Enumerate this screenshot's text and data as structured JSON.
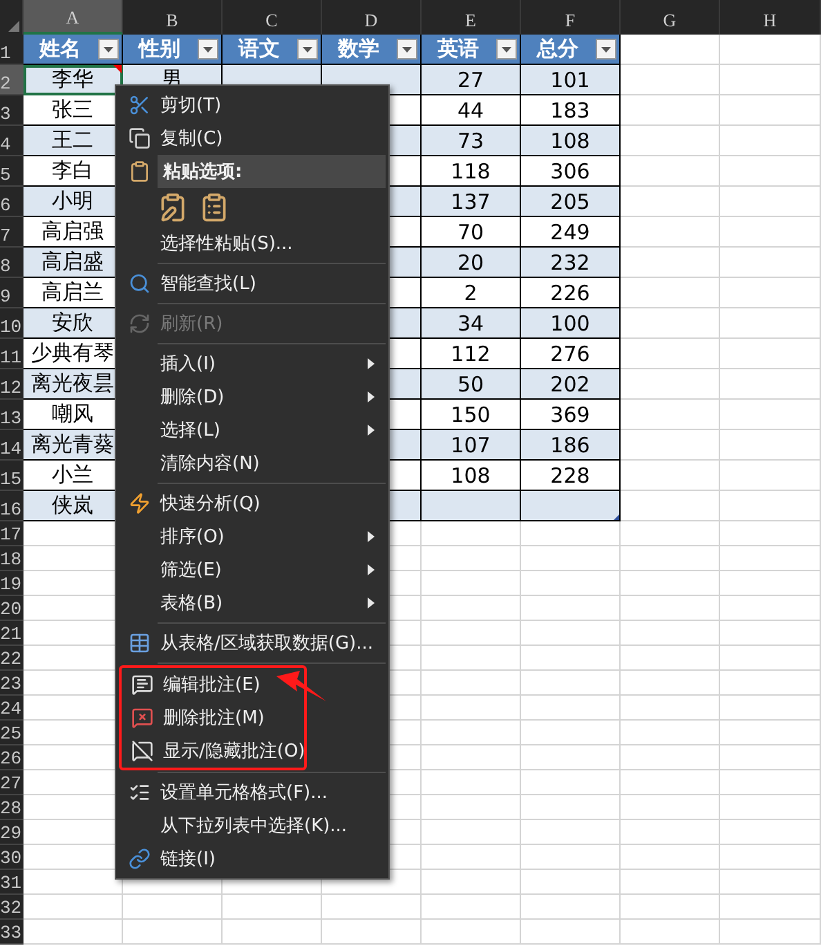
{
  "column_headers": [
    {
      "label": "A",
      "selected": true
    },
    {
      "label": "B",
      "selected": false
    },
    {
      "label": "C",
      "selected": false
    },
    {
      "label": "D",
      "selected": false
    },
    {
      "label": "E",
      "selected": false
    },
    {
      "label": "F",
      "selected": false
    },
    {
      "label": "G",
      "selected": false
    },
    {
      "label": "H",
      "selected": false
    }
  ],
  "row_numbers": [
    "1",
    "2",
    "3",
    "4",
    "5",
    "6",
    "7",
    "8",
    "9",
    "10",
    "11",
    "12",
    "13",
    "14",
    "15",
    "16",
    "17",
    "18",
    "19",
    "20",
    "21",
    "22",
    "23",
    "24",
    "25",
    "26",
    "27",
    "28",
    "29",
    "30",
    "31",
    "32",
    "33"
  ],
  "table": {
    "columns": [
      "姓名",
      "性别",
      "语文",
      "数学",
      "英语",
      "总分"
    ],
    "rows": [
      {
        "name": "李华",
        "gender": "男",
        "english": "27",
        "total": "101",
        "selected": true,
        "has_comment": true
      },
      {
        "name": "张三",
        "english": "44",
        "total": "183",
        "selected": false,
        "has_comment": false
      },
      {
        "name": "王二",
        "english": "73",
        "total": "108",
        "selected": false,
        "has_comment": false
      },
      {
        "name": "李白",
        "english": "118",
        "total": "306",
        "selected": false,
        "has_comment": false
      },
      {
        "name": "小明",
        "english": "137",
        "total": "205",
        "selected": false,
        "has_comment": false
      },
      {
        "name": "高启强",
        "english": "70",
        "total": "249",
        "selected": false,
        "has_comment": false
      },
      {
        "name": "高启盛",
        "english": "20",
        "total": "232",
        "selected": false,
        "has_comment": false
      },
      {
        "name": "高启兰",
        "english": "2",
        "total": "226",
        "selected": false,
        "has_comment": false
      },
      {
        "name": "安欣",
        "english": "34",
        "total": "100",
        "selected": false,
        "has_comment": false
      },
      {
        "name": "少典有琴",
        "english": "112",
        "total": "276",
        "selected": false,
        "has_comment": false
      },
      {
        "name": "离光夜昙",
        "english": "50",
        "total": "202",
        "selected": false,
        "has_comment": false
      },
      {
        "name": "嘲风",
        "english": "150",
        "total": "369",
        "selected": false,
        "has_comment": false
      },
      {
        "name": "离光青葵",
        "english": "107",
        "total": "186",
        "selected": false,
        "has_comment": false
      },
      {
        "name": "小兰",
        "english": "108",
        "total": "228",
        "selected": false,
        "has_comment": false
      },
      {
        "name": "侠岚",
        "selected": false,
        "has_comment": false
      }
    ]
  },
  "context_menu": {
    "items": [
      {
        "kind": "command",
        "label": "剪切(T)",
        "disabled": false,
        "highlighted": false,
        "annotated": false
      },
      {
        "kind": "command",
        "label": "复制(C)",
        "disabled": false,
        "highlighted": false,
        "annotated": false
      },
      {
        "kind": "header",
        "label": "粘贴选项:",
        "disabled": false,
        "highlighted": true,
        "annotated": false
      },
      {
        "kind": "paste_icons"
      },
      {
        "kind": "command",
        "label": "选择性粘贴(S)...",
        "disabled": false,
        "highlighted": false,
        "annotated": false
      },
      {
        "kind": "separator"
      },
      {
        "kind": "command",
        "label": "智能查找(L)",
        "disabled": false,
        "highlighted": false,
        "annotated": false
      },
      {
        "kind": "separator"
      },
      {
        "kind": "command",
        "label": "刷新(R)",
        "disabled": true,
        "highlighted": false,
        "annotated": false
      },
      {
        "kind": "separator"
      },
      {
        "kind": "submenu",
        "label": "插入(I)",
        "disabled": false,
        "highlighted": false,
        "annotated": false
      },
      {
        "kind": "submenu",
        "label": "删除(D)",
        "disabled": false,
        "highlighted": false,
        "annotated": false
      },
      {
        "kind": "submenu",
        "label": "选择(L)",
        "disabled": false,
        "highlighted": false,
        "annotated": false
      },
      {
        "kind": "command",
        "label": "清除内容(N)",
        "disabled": false,
        "highlighted": false,
        "annotated": false
      },
      {
        "kind": "separator"
      },
      {
        "kind": "command",
        "label": "快速分析(Q)",
        "disabled": false,
        "highlighted": false,
        "annotated": false
      },
      {
        "kind": "submenu",
        "label": "排序(O)",
        "disabled": false,
        "highlighted": false,
        "annotated": false
      },
      {
        "kind": "submenu",
        "label": "筛选(E)",
        "disabled": false,
        "highlighted": false,
        "annotated": false
      },
      {
        "kind": "submenu",
        "label": "表格(B)",
        "disabled": false,
        "highlighted": false,
        "annotated": false
      },
      {
        "kind": "separator"
      },
      {
        "kind": "command",
        "label": "从表格/区域获取数据(G)...",
        "disabled": false,
        "highlighted": false,
        "annotated": false
      },
      {
        "kind": "separator"
      },
      {
        "kind": "command",
        "label": "编辑批注(E)",
        "disabled": false,
        "highlighted": false,
        "annotated": true
      },
      {
        "kind": "command",
        "label": "删除批注(M)",
        "disabled": false,
        "highlighted": false,
        "annotated": true
      },
      {
        "kind": "command",
        "label": "显示/隐藏批注(O)",
        "disabled": false,
        "highlighted": false,
        "annotated": true
      },
      {
        "kind": "separator"
      },
      {
        "kind": "command",
        "label": "设置单元格格式(F)...",
        "disabled": false,
        "highlighted": false,
        "annotated": false
      },
      {
        "kind": "command",
        "label": "从下拉列表中选择(K)...",
        "disabled": false,
        "highlighted": false,
        "annotated": false
      },
      {
        "kind": "command",
        "label": "链接(I)",
        "disabled": false,
        "highlighted": false,
        "annotated": false
      }
    ]
  }
}
